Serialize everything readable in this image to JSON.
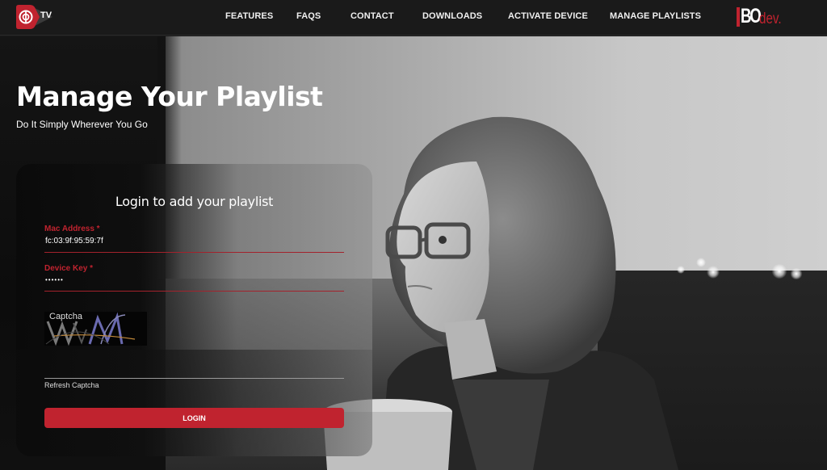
{
  "header": {
    "logo_text": "TV",
    "nav": [
      {
        "label": "FEATURES"
      },
      {
        "label": "FAQS"
      },
      {
        "label": "CONTACT"
      },
      {
        "label": "DOWNLOADS"
      },
      {
        "label": "ACTIVATE DEVICE"
      },
      {
        "label": "MANAGE PLAYLISTS"
      }
    ],
    "brand": {
      "primary": "BO",
      "secondary": "dev."
    }
  },
  "hero": {
    "title": "Manage Your Playlist",
    "subtitle": "Do It Simply Wherever You Go"
  },
  "login": {
    "title": "Login to add your playlist",
    "mac_label": "Mac Address *",
    "mac_value": "fc:03:9f:95:59:7f",
    "key_label": "Device Key *",
    "key_value": "••••••",
    "captcha_label": "Captcha",
    "captcha_value": "",
    "refresh_label": "Refresh Captcha",
    "login_label": "LOGIN"
  },
  "colors": {
    "accent": "#c0232f",
    "header_bg": "#1a1a1a"
  }
}
